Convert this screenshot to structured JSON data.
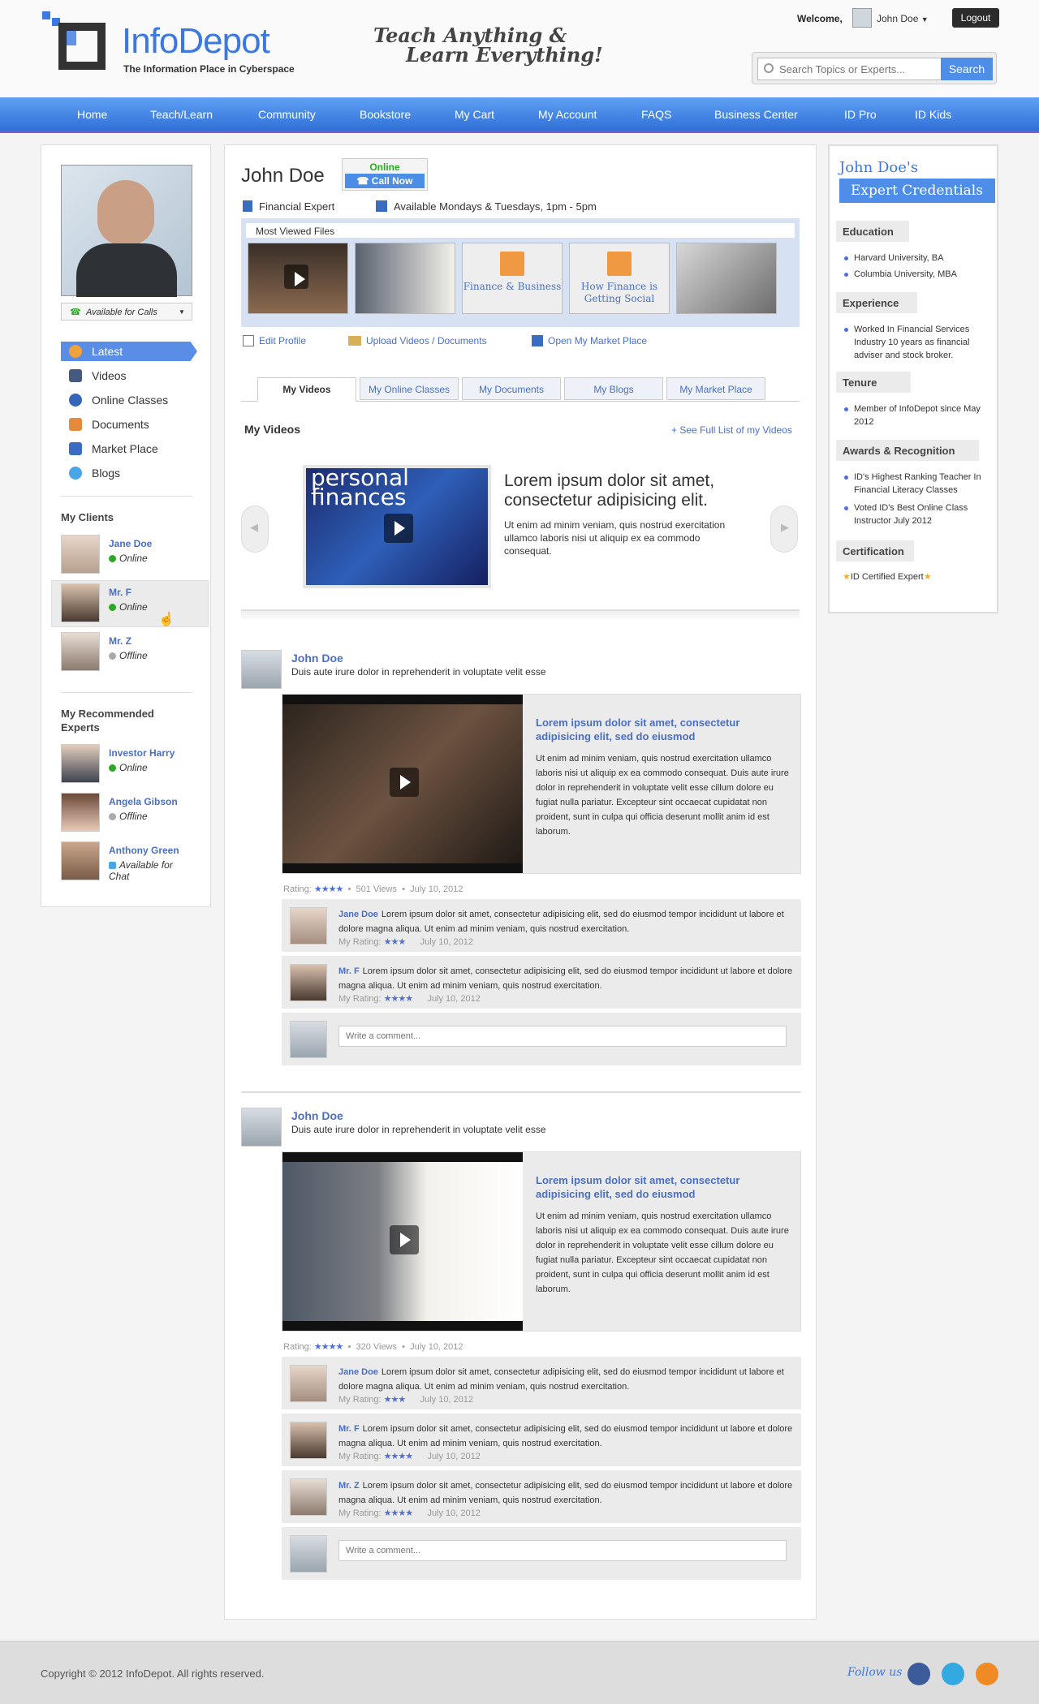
{
  "header": {
    "logo_name": "InfoDepot",
    "logo_tagline": "The Information Place in Cyberspace",
    "slogan_line1": "Teach Anything &",
    "slogan_line2": "Learn Everything!",
    "welcome": "Welcome,",
    "user_name": "John Doe",
    "logout": "Logout",
    "search_placeholder": "Search Topics or Experts...",
    "search_button": "Search"
  },
  "nav": [
    "Home",
    "Teach/Learn",
    "Community",
    "Bookstore",
    "My Cart",
    "My Account",
    "FAQS",
    "Business Center",
    "ID Pro",
    "ID Kids"
  ],
  "sidebar": {
    "avail_calls": "Available for Calls",
    "items": [
      "Latest",
      "Videos",
      "Online Classes",
      "Documents",
      "Market Place",
      "Blogs"
    ],
    "my_clients_title": "My Clients",
    "clients": [
      {
        "name": "Jane Doe",
        "status": "Online"
      },
      {
        "name": "Mr. F",
        "status": "Online"
      },
      {
        "name": "Mr. Z",
        "status": "Offline"
      }
    ],
    "experts_title_1": "My Recommended",
    "experts_title_2": "Experts",
    "experts": [
      {
        "name": "Investor Harry",
        "status": "Online"
      },
      {
        "name": "Angela Gibson",
        "status": "Offline"
      },
      {
        "name": "Anthony Green",
        "status": "Available for Chat"
      }
    ]
  },
  "profile": {
    "name": "John Doe",
    "online": "Online",
    "call_now": "Call Now",
    "role": "Financial Expert",
    "availability": "Available Mondays & Tuesdays, 1pm - 5pm",
    "most_viewed": "Most Viewed Files",
    "files": [
      "",
      "",
      "Finance & Business",
      "How Finance is Getting Social",
      ""
    ],
    "actions": [
      "Edit Profile",
      "Upload Videos / Documents",
      "Open My Market Place"
    ],
    "tabs": [
      "My Videos",
      "My Online Classes",
      "My Documents",
      "My Blogs",
      "My Market Place"
    ],
    "section_title": "My Videos",
    "see_full": "+ See Full List of my Videos",
    "featured": {
      "thumb_line1": "personal",
      "thumb_line2": "finances",
      "title": "Lorem ipsum dolor sit amet, consectetur adipisicing elit.",
      "desc": "Ut enim ad minim veniam, quis nostrud exercitation ullamco laboris nisi ut aliquip ex ea commodo consequat."
    }
  },
  "posts": [
    {
      "author": "John Doe",
      "text": "Duis aute irure dolor in reprehenderit in voluptate velit esse",
      "video_title": "Lorem ipsum dolor sit amet, consectetur adipisicing elit, sed do eiusmod",
      "video_desc": "Ut enim ad minim veniam, quis nostrud exercitation ullamco laboris nisi ut aliquip ex ea commodo consequat. Duis aute irure dolor in reprehenderit in voluptate velit esse cillum dolore eu fugiat nulla pariatur. Excepteur sint occaecat cupidatat non proident, sunt in culpa qui officia deserunt mollit anim id est laborum.",
      "rating_label": "Rating:",
      "stars": "★★★★",
      "views": "501 Views",
      "date": "July 10, 2012",
      "comments": [
        {
          "name": "Jane Doe",
          "text": "Lorem ipsum dolor sit amet, consectetur adipisicing elit, sed do eiusmod tempor incididunt ut labore et dolore magna aliqua. Ut enim ad minim veniam, quis nostrud exercitation.",
          "rating_label": "My Rating:",
          "stars": "★★★",
          "date": "July 10, 2012"
        },
        {
          "name": "Mr. F",
          "text": "Lorem ipsum dolor sit amet, consectetur adipisicing elit, sed do eiusmod tempor incididunt ut labore et dolore magna aliqua. Ut enim ad minim veniam, quis nostrud exercitation.",
          "rating_label": "My Rating:",
          "stars": "★★★★",
          "date": "July 10, 2012"
        }
      ],
      "comment_placeholder": "Write a comment..."
    },
    {
      "author": "John Doe",
      "text": "Duis aute irure dolor in reprehenderit in voluptate velit esse",
      "video_title": "Lorem ipsum dolor sit amet, consectetur adipisicing elit, sed do eiusmod",
      "video_desc": "Ut enim ad minim veniam, quis nostrud exercitation ullamco laboris nisi ut aliquip ex ea commodo consequat. Duis aute irure dolor in reprehenderit in voluptate velit esse cillum dolore eu fugiat nulla pariatur. Excepteur sint occaecat cupidatat non proident, sunt in culpa qui officia deserunt mollit anim id est laborum.",
      "rating_label": "Rating:",
      "stars": "★★★★",
      "views": "320 Views",
      "date": "July 10, 2012",
      "comments": [
        {
          "name": "Jane Doe",
          "text": "Lorem ipsum dolor sit amet, consectetur adipisicing elit, sed do eiusmod tempor incididunt ut labore et dolore magna aliqua. Ut enim ad minim veniam, quis nostrud exercitation.",
          "rating_label": "My Rating:",
          "stars": "★★★",
          "date": "July 10, 2012"
        },
        {
          "name": "Mr. F",
          "text": "Lorem ipsum dolor sit amet, consectetur adipisicing elit, sed do eiusmod tempor incididunt ut labore et dolore magna aliqua. Ut enim ad minim veniam, quis nostrud exercitation.",
          "rating_label": "My Rating:",
          "stars": "★★★★",
          "date": "July 10, 2012"
        },
        {
          "name": "Mr. Z",
          "text": "Lorem ipsum dolor sit amet, consectetur adipisicing elit, sed do eiusmod tempor incididunt ut labore et dolore magna aliqua. Ut enim ad minim veniam, quis nostrud exercitation.",
          "rating_label": "My Rating:",
          "stars": "★★★★",
          "date": "July 10, 2012"
        }
      ],
      "comment_placeholder": "Write a comment..."
    }
  ],
  "credentials": {
    "name": "John Doe's",
    "title": "Expert Credentials",
    "education_h": "Education",
    "education": [
      "Harvard University, BA",
      "Columbia University, MBA"
    ],
    "experience_h": "Experience",
    "experience": [
      "Worked In Financial Services Industry 10 years as financial adviser and stock broker."
    ],
    "tenure_h": "Tenure",
    "tenure": [
      "Member of InfoDepot since May 2012"
    ],
    "awards_h": "Awards & Recognition",
    "awards": [
      "ID's Highest Ranking Teacher In Financial Literacy Classes",
      "Voted ID's Best Online Class Instructor July 2012"
    ],
    "cert_h": "Certification",
    "cert": "ID Certified Expert"
  },
  "footer": {
    "copyright": "Copyright © 2012 InfoDepot. All rights reserved.",
    "follow": "Follow us"
  },
  "colors": {
    "accent": "#4f8ee8",
    "link": "#4a6fc4",
    "online": "#2ea626",
    "offline": "#aaaaaa"
  }
}
